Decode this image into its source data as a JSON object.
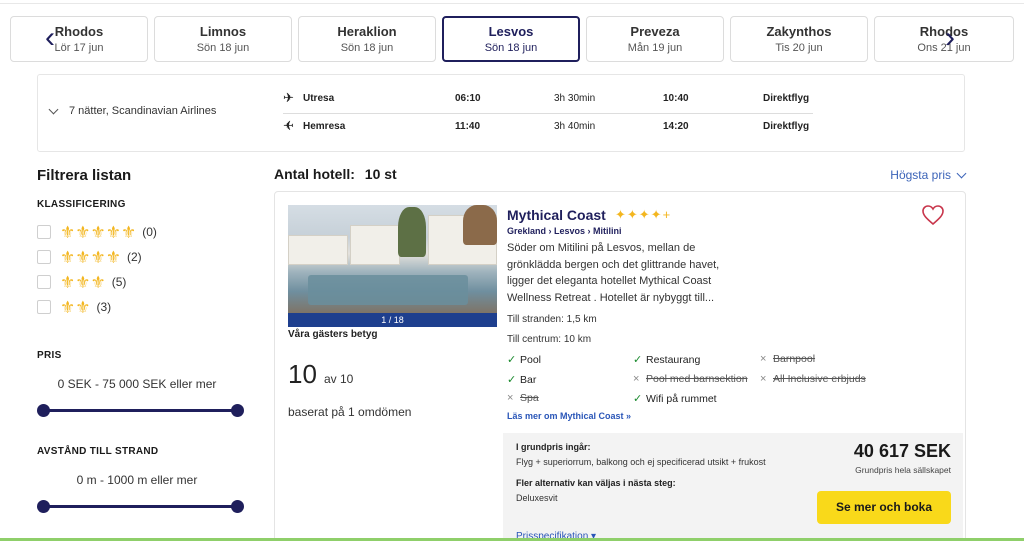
{
  "date_tabs": [
    {
      "destination": "Rhodos",
      "date": "Lör 17 jun"
    },
    {
      "destination": "Limnos",
      "date": "Sön 18 jun"
    },
    {
      "destination": "Heraklion",
      "date": "Sön 18 jun"
    },
    {
      "destination": "Lesvos",
      "date": "Sön 18 jun",
      "active": true
    },
    {
      "destination": "Preveza",
      "date": "Mån 19 jun"
    },
    {
      "destination": "Zakynthos",
      "date": "Tis 20 jun"
    },
    {
      "destination": "Rhodos",
      "date": "Ons 21 jun"
    }
  ],
  "nav": {
    "prev_icon": "‹",
    "next_icon": "›"
  },
  "flight": {
    "summary": "7 nätter, Scandinavian Airlines",
    "outbound": {
      "label": "Utresa",
      "depart": "06:10",
      "duration": "3h 30min",
      "arrive": "10:40",
      "type": "Direktflyg"
    },
    "return": {
      "label": "Hemresa",
      "depart": "11:40",
      "duration": "3h 40min",
      "arrive": "14:20",
      "type": "Direktflyg"
    }
  },
  "filters": {
    "title": "Filtrera listan",
    "classification": {
      "title": "KLASSIFICERING",
      "options": [
        {
          "stars": "⚜⚜⚜⚜⚜",
          "count": "(0)"
        },
        {
          "stars": "⚜⚜⚜⚜",
          "count": "(2)"
        },
        {
          "stars": "⚜⚜⚜",
          "count": "(5)"
        },
        {
          "stars": "⚜⚜",
          "count": "(3)"
        }
      ]
    },
    "price": {
      "title": "PRIS",
      "range": "0 SEK - 75 000 SEK eller mer",
      "min_fraction": 0,
      "max_fraction": 1
    },
    "beach_distance": {
      "title": "AVSTÅND TILL STRAND",
      "range": "0 m - 1000 m eller mer",
      "min_fraction": 0,
      "max_fraction": 1
    }
  },
  "results": {
    "count_label": "Antal hotell:",
    "count_value": "10 st",
    "sort_label": "Högsta pris"
  },
  "hotel": {
    "name": "Mythical Coast",
    "stars": "✦✦✦✦+",
    "breadcrumb": "Grekland › Lesvos › Mitilini",
    "description": "Söder om Mitilini på Lesvos, mellan de grönklädda bergen och det glittrande havet, ligger det eleganta hotellet Mythical Coast Wellness Retreat . Hotellet är nybyggt till...",
    "photo_counter": "1 / 18",
    "reviews_title": "Våra gästers betyg",
    "score": "10",
    "score_of": "av 10",
    "review_basis": "baserat på 1 omdömen",
    "beach_distance": "Till stranden:  1,5 km",
    "center_distance": "Till centrum:  10 km",
    "facilities": [
      {
        "label": "Pool",
        "available": true
      },
      {
        "label": "Restaurang",
        "available": true
      },
      {
        "label": "Barnpool",
        "available": false
      },
      {
        "label": "Bar",
        "available": true
      },
      {
        "label": "Pool med barnsektion",
        "available": false
      },
      {
        "label": "All Inclusive erbjuds",
        "available": false
      },
      {
        "label": "Spa",
        "available": false
      },
      {
        "label": "Wifi på rummet",
        "available": true
      }
    ],
    "more_link": "Läs mer om Mythical Coast »",
    "price_box": {
      "included_label": "I grundpris ingår:",
      "included_text": "Flyg + superiorrum, balkong och ej specificerad utsikt + frukost",
      "options_label": "Fler alternativ kan väljas i nästa steg:",
      "options_text": "Deluxesvit",
      "price": "40 617 SEK",
      "price_note": "Grundpris hela sällskapet",
      "book_label": "Se mer och boka",
      "spec_link": "Prisspecifikation ▾"
    }
  },
  "colors": {
    "accent": "#1f1f5c",
    "link": "#2a56b8",
    "star": "#f3b61f",
    "book": "#f9d91a"
  }
}
